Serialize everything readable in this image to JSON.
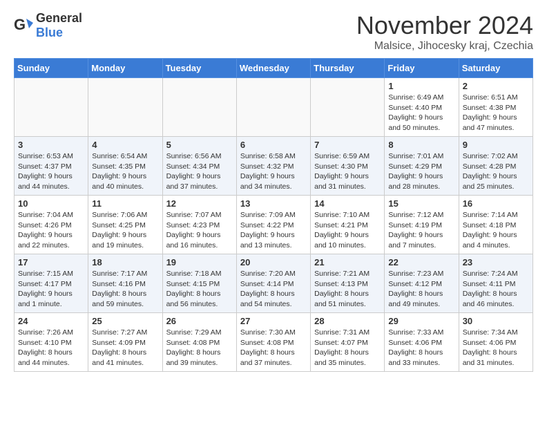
{
  "logo": {
    "general": "General",
    "blue": "Blue"
  },
  "title": "November 2024",
  "location": "Malsice, Jihocesky kraj, Czechia",
  "weekdays": [
    "Sunday",
    "Monday",
    "Tuesday",
    "Wednesday",
    "Thursday",
    "Friday",
    "Saturday"
  ],
  "weeks": [
    [
      {
        "day": "",
        "info": ""
      },
      {
        "day": "",
        "info": ""
      },
      {
        "day": "",
        "info": ""
      },
      {
        "day": "",
        "info": ""
      },
      {
        "day": "",
        "info": ""
      },
      {
        "day": "1",
        "info": "Sunrise: 6:49 AM\nSunset: 4:40 PM\nDaylight: 9 hours\nand 50 minutes."
      },
      {
        "day": "2",
        "info": "Sunrise: 6:51 AM\nSunset: 4:38 PM\nDaylight: 9 hours\nand 47 minutes."
      }
    ],
    [
      {
        "day": "3",
        "info": "Sunrise: 6:53 AM\nSunset: 4:37 PM\nDaylight: 9 hours\nand 44 minutes."
      },
      {
        "day": "4",
        "info": "Sunrise: 6:54 AM\nSunset: 4:35 PM\nDaylight: 9 hours\nand 40 minutes."
      },
      {
        "day": "5",
        "info": "Sunrise: 6:56 AM\nSunset: 4:34 PM\nDaylight: 9 hours\nand 37 minutes."
      },
      {
        "day": "6",
        "info": "Sunrise: 6:58 AM\nSunset: 4:32 PM\nDaylight: 9 hours\nand 34 minutes."
      },
      {
        "day": "7",
        "info": "Sunrise: 6:59 AM\nSunset: 4:30 PM\nDaylight: 9 hours\nand 31 minutes."
      },
      {
        "day": "8",
        "info": "Sunrise: 7:01 AM\nSunset: 4:29 PM\nDaylight: 9 hours\nand 28 minutes."
      },
      {
        "day": "9",
        "info": "Sunrise: 7:02 AM\nSunset: 4:28 PM\nDaylight: 9 hours\nand 25 minutes."
      }
    ],
    [
      {
        "day": "10",
        "info": "Sunrise: 7:04 AM\nSunset: 4:26 PM\nDaylight: 9 hours\nand 22 minutes."
      },
      {
        "day": "11",
        "info": "Sunrise: 7:06 AM\nSunset: 4:25 PM\nDaylight: 9 hours\nand 19 minutes."
      },
      {
        "day": "12",
        "info": "Sunrise: 7:07 AM\nSunset: 4:23 PM\nDaylight: 9 hours\nand 16 minutes."
      },
      {
        "day": "13",
        "info": "Sunrise: 7:09 AM\nSunset: 4:22 PM\nDaylight: 9 hours\nand 13 minutes."
      },
      {
        "day": "14",
        "info": "Sunrise: 7:10 AM\nSunset: 4:21 PM\nDaylight: 9 hours\nand 10 minutes."
      },
      {
        "day": "15",
        "info": "Sunrise: 7:12 AM\nSunset: 4:19 PM\nDaylight: 9 hours\nand 7 minutes."
      },
      {
        "day": "16",
        "info": "Sunrise: 7:14 AM\nSunset: 4:18 PM\nDaylight: 9 hours\nand 4 minutes."
      }
    ],
    [
      {
        "day": "17",
        "info": "Sunrise: 7:15 AM\nSunset: 4:17 PM\nDaylight: 9 hours\nand 1 minute."
      },
      {
        "day": "18",
        "info": "Sunrise: 7:17 AM\nSunset: 4:16 PM\nDaylight: 8 hours\nand 59 minutes."
      },
      {
        "day": "19",
        "info": "Sunrise: 7:18 AM\nSunset: 4:15 PM\nDaylight: 8 hours\nand 56 minutes."
      },
      {
        "day": "20",
        "info": "Sunrise: 7:20 AM\nSunset: 4:14 PM\nDaylight: 8 hours\nand 54 minutes."
      },
      {
        "day": "21",
        "info": "Sunrise: 7:21 AM\nSunset: 4:13 PM\nDaylight: 8 hours\nand 51 minutes."
      },
      {
        "day": "22",
        "info": "Sunrise: 7:23 AM\nSunset: 4:12 PM\nDaylight: 8 hours\nand 49 minutes."
      },
      {
        "day": "23",
        "info": "Sunrise: 7:24 AM\nSunset: 4:11 PM\nDaylight: 8 hours\nand 46 minutes."
      }
    ],
    [
      {
        "day": "24",
        "info": "Sunrise: 7:26 AM\nSunset: 4:10 PM\nDaylight: 8 hours\nand 44 minutes."
      },
      {
        "day": "25",
        "info": "Sunrise: 7:27 AM\nSunset: 4:09 PM\nDaylight: 8 hours\nand 41 minutes."
      },
      {
        "day": "26",
        "info": "Sunrise: 7:29 AM\nSunset: 4:08 PM\nDaylight: 8 hours\nand 39 minutes."
      },
      {
        "day": "27",
        "info": "Sunrise: 7:30 AM\nSunset: 4:08 PM\nDaylight: 8 hours\nand 37 minutes."
      },
      {
        "day": "28",
        "info": "Sunrise: 7:31 AM\nSunset: 4:07 PM\nDaylight: 8 hours\nand 35 minutes."
      },
      {
        "day": "29",
        "info": "Sunrise: 7:33 AM\nSunset: 4:06 PM\nDaylight: 8 hours\nand 33 minutes."
      },
      {
        "day": "30",
        "info": "Sunrise: 7:34 AM\nSunset: 4:06 PM\nDaylight: 8 hours\nand 31 minutes."
      }
    ]
  ]
}
